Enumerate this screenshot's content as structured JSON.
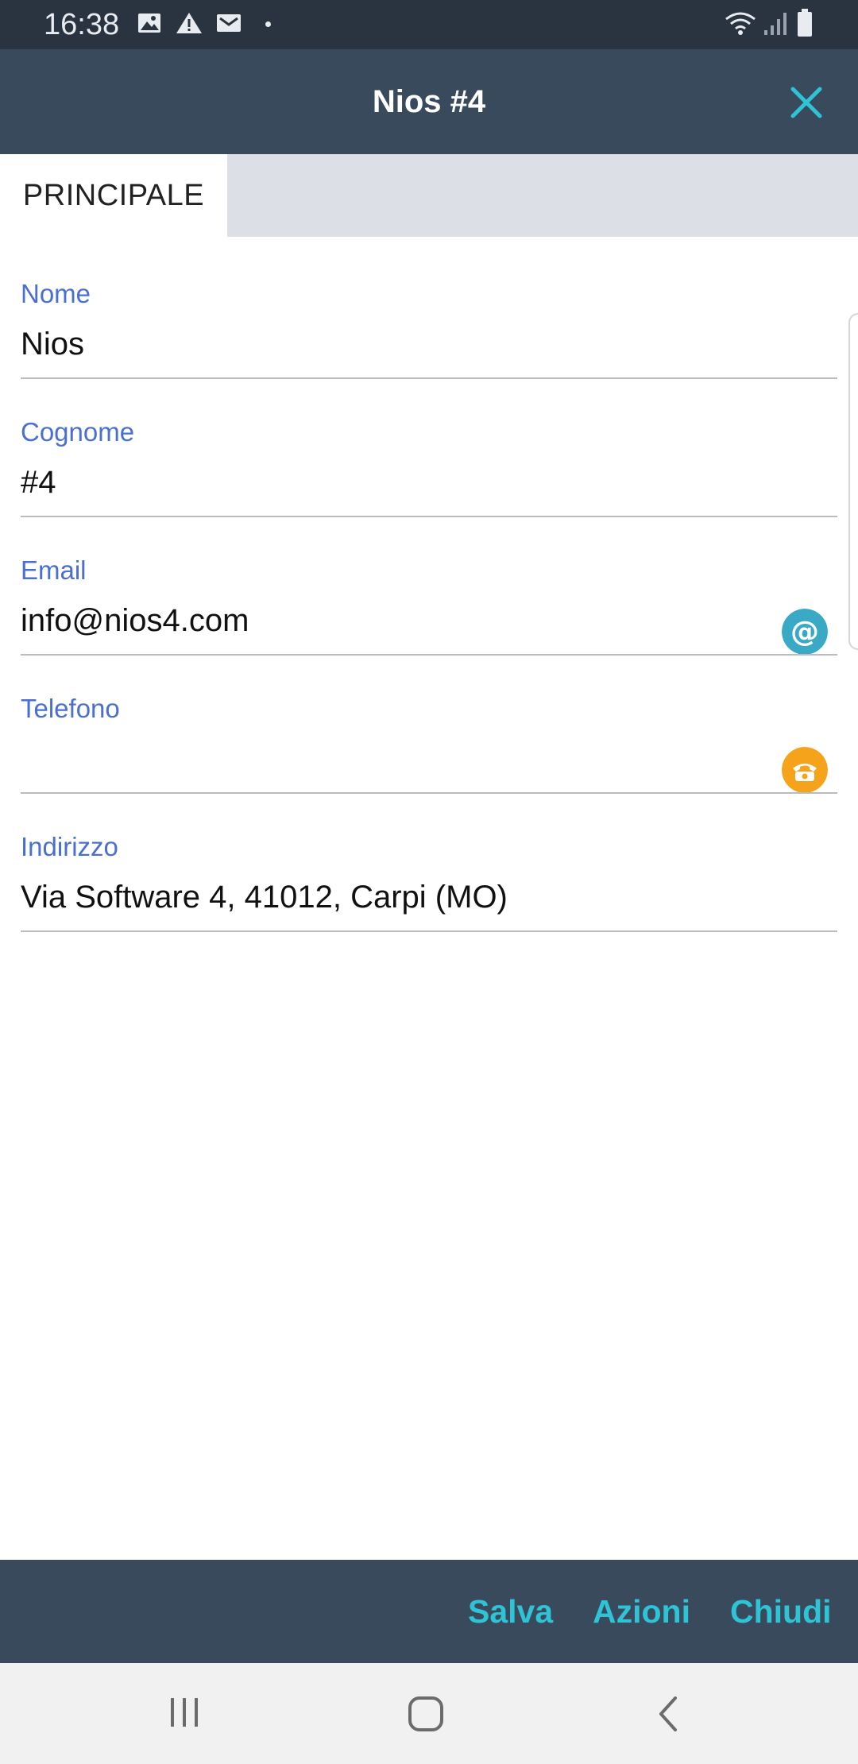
{
  "status_bar": {
    "time": "16:38",
    "left_icons": [
      "image-icon",
      "warning-icon",
      "mail-icon"
    ],
    "right_icons": [
      "wifi-icon",
      "signal-icon",
      "battery-icon"
    ]
  },
  "header": {
    "title": "Nios #4",
    "close_icon": "close-icon"
  },
  "tabs": [
    {
      "label": "PRINCIPALE",
      "active": true
    }
  ],
  "form": {
    "fields": [
      {
        "label": "Nome",
        "value": "Nios"
      },
      {
        "label": "Cognome",
        "value": "#4"
      },
      {
        "label": "Email",
        "value": "info@nios4.com",
        "action_icon": "at-icon",
        "action_color": "#3aa9c6"
      },
      {
        "label": "Telefono",
        "value": "",
        "action_icon": "phone-icon",
        "action_color": "#f5a31a"
      },
      {
        "label": "Indirizzo",
        "value": "Via Software 4, 41012, Carpi (MO)"
      }
    ]
  },
  "bottom_bar": {
    "save_label": "Salva",
    "actions_label": "Azioni",
    "close_label": "Chiudi"
  },
  "nav_bar": {
    "icons": [
      "recent-apps-icon",
      "home-icon",
      "back-icon"
    ]
  },
  "colors": {
    "header_bg": "#3a4a5d",
    "status_bg": "#2a3441",
    "accent": "#2ec4d6",
    "label": "#4a6fd1"
  }
}
